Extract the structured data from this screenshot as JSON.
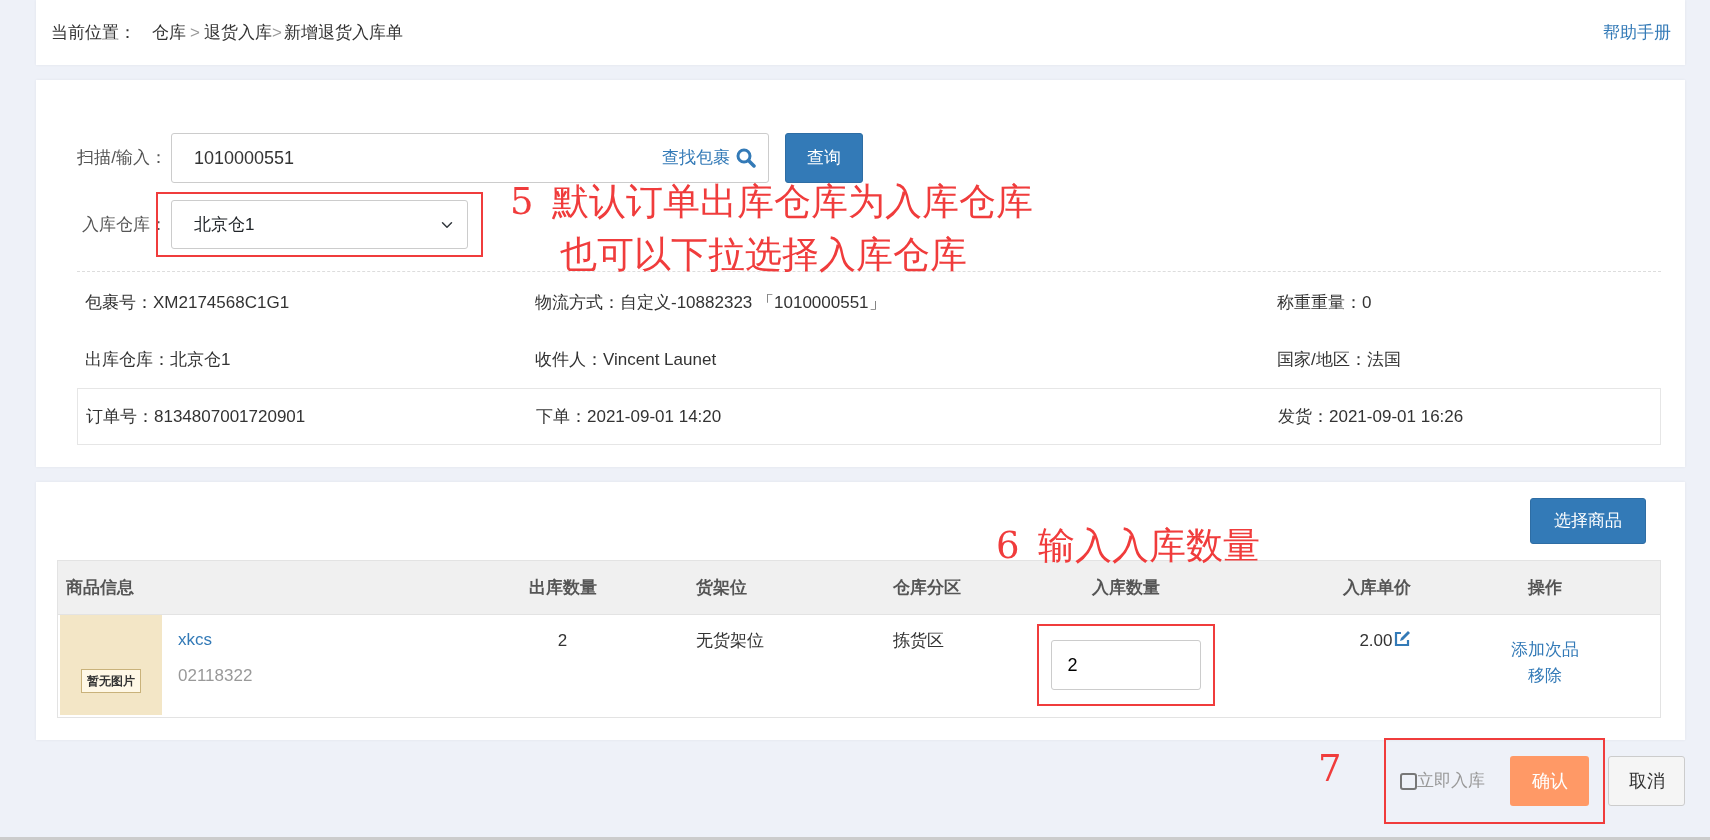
{
  "breadcrumb": {
    "label": "当前位置：",
    "items": [
      "仓库",
      "退货入库",
      "新增退货入库单"
    ],
    "separator": ">"
  },
  "help_link": "帮助手册",
  "search": {
    "label": "扫描/输入：",
    "value": "1010000551",
    "find_link": "查找包裹",
    "button": "查询"
  },
  "warehouse": {
    "label": "入库仓库：",
    "value": "北京仓1"
  },
  "info_rows": [
    {
      "boxed": false,
      "fields": [
        {
          "label": "包裹号：",
          "value": "XM2174568C1G1"
        },
        {
          "label": "物流方式：",
          "value": "自定义-10882323 「1010000551」"
        },
        {
          "label": "称重重量：",
          "value": "0"
        }
      ]
    },
    {
      "boxed": false,
      "fields": [
        {
          "label": "出库仓库：",
          "value": "北京仓1"
        },
        {
          "label": "收件人：",
          "value": "Vincent Launet"
        },
        {
          "label": "国家/地区：",
          "value": "法国"
        }
      ]
    },
    {
      "boxed": true,
      "fields": [
        {
          "label": "订单号：",
          "value": "8134807001720901"
        },
        {
          "label": "下单：",
          "value": "2021-09-01 14:20"
        },
        {
          "label": "发货：",
          "value": "2021-09-01 16:26"
        }
      ]
    }
  ],
  "select_button": "选择商品",
  "table": {
    "columns": [
      "商品信息",
      "出库数量",
      "货架位",
      "仓库分区",
      "入库数量",
      "入库单价",
      "操作"
    ],
    "rows": [
      {
        "image_text": "暂无图片",
        "name": "xkcs",
        "sku": "02118322",
        "out_qty": "2",
        "shelf": "无货架位",
        "zone": "拣货区",
        "in_qty": "2",
        "price": "2.00",
        "actions": [
          "添加次品",
          "移除"
        ]
      }
    ]
  },
  "footer": {
    "immediate": {
      "label": "立即入库",
      "checked": false
    },
    "confirm": "确认",
    "cancel": "取消"
  },
  "annotations": [
    {
      "number": "5",
      "lines": [
        "默认订单出库仓库为入库仓库",
        "也可以下拉选择入库仓库"
      ]
    },
    {
      "number": "6",
      "lines": [
        "输入入库数量"
      ]
    },
    {
      "number": "7"
    }
  ]
}
